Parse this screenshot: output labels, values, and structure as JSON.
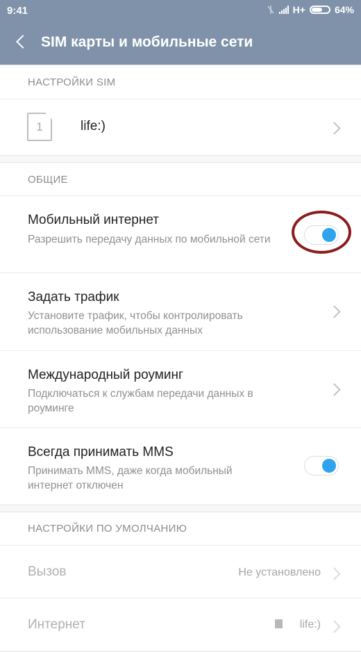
{
  "status_bar": {
    "time": "9:41",
    "network": "H+",
    "battery": "64%",
    "battery_level": 0.64
  },
  "app_bar": {
    "title": "SIM карты и мобильные сети"
  },
  "sim_section": {
    "header": "НАСТРОЙКИ SIM",
    "slot_number": "1",
    "carrier": "life:)"
  },
  "general": {
    "header": "ОБЩИЕ",
    "mobile_internet": {
      "title": "Мобильный интернет",
      "subtitle": "Разрешить передачу данных по мобильной сети",
      "enabled": true
    },
    "traffic": {
      "title": "Задать трафик",
      "subtitle": "Установите трафик, чтобы контролировать использование мобильных данных"
    },
    "roaming": {
      "title": "Международный роуминг",
      "subtitle": "Подключаться к службам передачи данных в роуминге"
    },
    "mms": {
      "title": "Всегда принимать MMS",
      "subtitle": "Принимать MMS, даже когда мобильный интернет отключен",
      "enabled": true
    }
  },
  "defaults": {
    "header": "НАСТРОЙКИ ПО УМОЛЧАНИЮ",
    "calls": {
      "title": "Вызов",
      "value": "Не установлено"
    },
    "internet": {
      "title": "Интернет",
      "value": "life:)"
    }
  },
  "colors": {
    "accent": "#30a3ee",
    "header_bg": "#7f92a9",
    "highlight_ring": "#8a1d1d"
  }
}
